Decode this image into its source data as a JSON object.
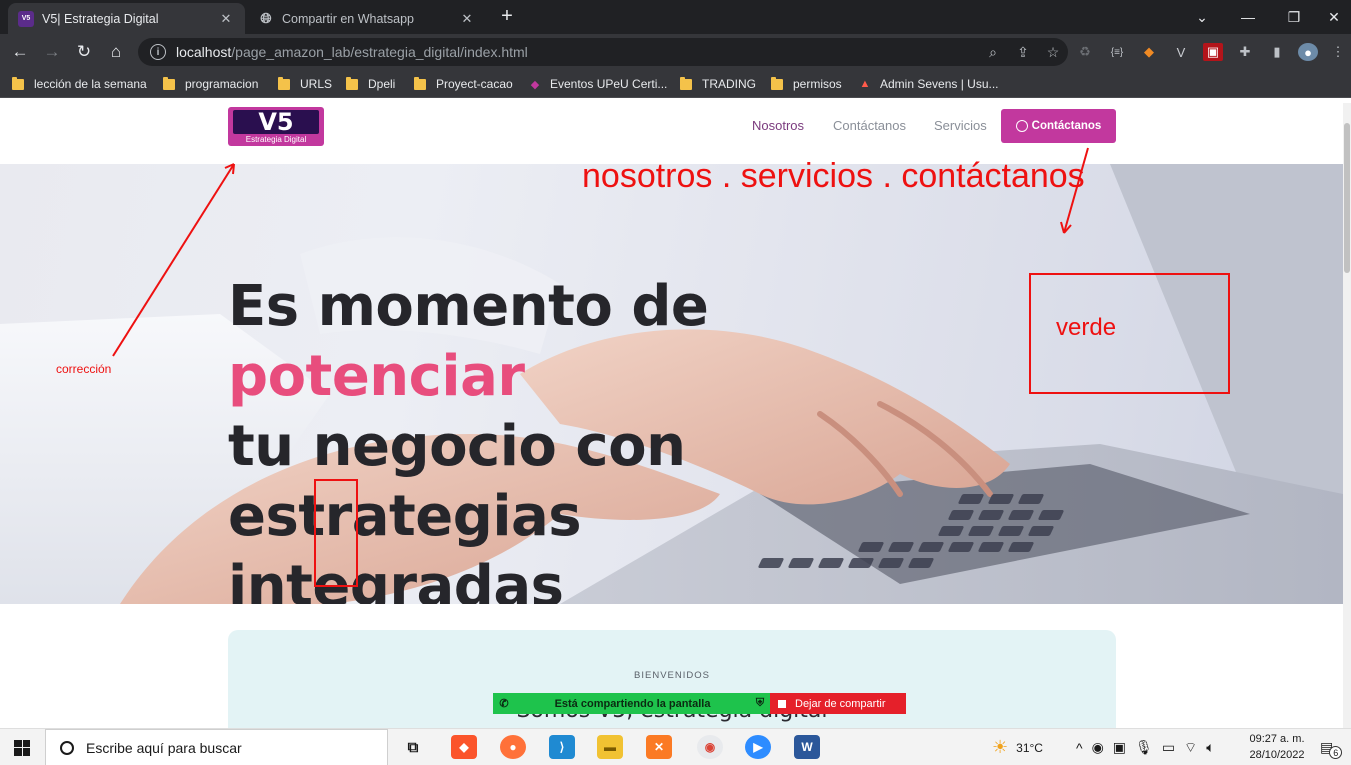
{
  "browser": {
    "tabs": [
      {
        "title": "V5| Estrategia Digital",
        "favicon": "V5",
        "active": true
      },
      {
        "title": "Compartir en Whatsapp",
        "favicon": "globe-icon",
        "active": false
      }
    ],
    "new_tab_icon": "+",
    "url_host": "localhost",
    "url_path": "/page_amazon_lab/estrategia_digital/index.html",
    "bookmarks": [
      {
        "label": "lección de la semana",
        "icon": "folder-icon"
      },
      {
        "label": "programacion",
        "icon": "folder-icon"
      },
      {
        "label": "URLS",
        "icon": "folder-icon"
      },
      {
        "label": "Dpeli",
        "icon": "folder-icon"
      },
      {
        "label": "Proyect-cacao",
        "icon": "folder-icon"
      },
      {
        "label": "Eventos UPeU Certi...",
        "icon": "upeu-icon"
      },
      {
        "label": "TRADING",
        "icon": "folder-icon"
      },
      {
        "label": "permisos",
        "icon": "folder-icon"
      },
      {
        "label": "Admin Sevens | Usu...",
        "icon": "admin-icon"
      }
    ]
  },
  "site": {
    "logo_text": "V5",
    "logo_sub": "Estrategia Digital",
    "nav": [
      "Nosotros",
      "Contáctanos",
      "Servicios"
    ],
    "cta_label": "Contáctanos",
    "brand_color": "#c2389e",
    "hero": {
      "line1_pre": "Es momento de ",
      "line1_accent": "potenciar",
      "line2": "tu negocio con estrategias",
      "line3": "integradas",
      "accent_color": "#e84d7d"
    },
    "card": {
      "eyebrow": "BIENVENIDOS",
      "title": "Somos V5, estrategia digital"
    }
  },
  "annotations": {
    "menu_note": "nosotros . servicios . contáctanos",
    "color_note": "verde",
    "logo_note": "corrección"
  },
  "share_bar": {
    "status": "Está compartiendo la pantalla",
    "stop": "Dejar de compartir"
  },
  "taskbar": {
    "search_placeholder": "Escribe aquí para buscar",
    "weather": "31°C",
    "time": "09:27 a. m.",
    "date": "28/10/2022",
    "notifications": "6"
  }
}
